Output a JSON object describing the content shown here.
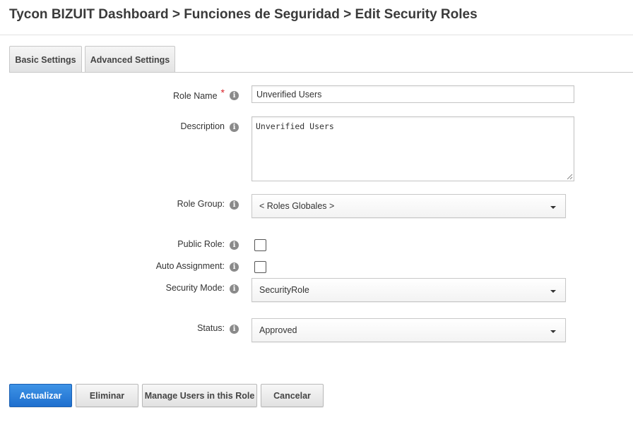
{
  "breadcrumb": "Tycon BIZUIT Dashboard > Funciones de Seguridad > Edit Security Roles",
  "tabs": {
    "basic": "Basic Settings",
    "advanced": "Advanced Settings"
  },
  "form": {
    "role_name": {
      "label": "Role Name",
      "required_mark": "*",
      "value": "Unverified Users"
    },
    "description": {
      "label": "Description",
      "value": "Unverified Users"
    },
    "role_group": {
      "label": "Role Group:",
      "value": "< Roles Globales >"
    },
    "public_role": {
      "label": "Public Role:",
      "checked": false
    },
    "auto_assignment": {
      "label": "Auto Assignment:",
      "checked": false
    },
    "security_mode": {
      "label": "Security Mode:",
      "value": "SecurityRole"
    },
    "status": {
      "label": "Status:",
      "value": "Approved"
    }
  },
  "info_glyph": "i",
  "buttons": {
    "update": "Actualizar",
    "delete": "Eliminar",
    "manage_users": "Manage Users in this Role",
    "cancel": "Cancelar"
  },
  "icons": {
    "info": "info-circle-icon",
    "caret": "chevron-down-icon",
    "resize": "resize-grip-icon"
  },
  "colors": {
    "primary_button": "#2a7fd9",
    "required": "#d9232a"
  }
}
